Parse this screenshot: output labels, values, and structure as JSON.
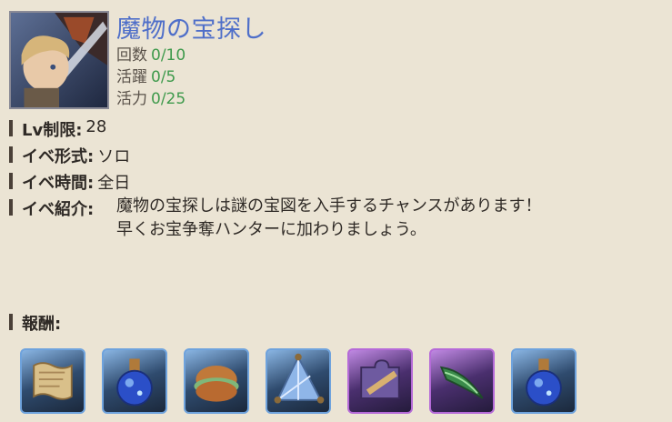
{
  "event": {
    "title": "魔物の宝探し",
    "stats": [
      {
        "label": "回数",
        "value": "0/10"
      },
      {
        "label": "活躍",
        "value": "0/5"
      },
      {
        "label": "活力",
        "value": "0/25"
      }
    ]
  },
  "info": {
    "level_key": "Lv制限:",
    "level_value": "28",
    "format_key": "イベ形式:",
    "format_value": "ソロ",
    "time_key": "イベ時間:",
    "time_value": "全日",
    "intro_key": "イベ紹介:",
    "intro_line1": "魔物の宝探しは謎の宝図を入手するチャンスがあります！",
    "intro_line2": "早くお宝争奪ハンターに加わりましょう。"
  },
  "rewards": {
    "heading": "報酬:",
    "items": [
      {
        "icon": "treasure-map-icon",
        "rarity": "blue"
      },
      {
        "icon": "blue-potion-icon",
        "rarity": "blue"
      },
      {
        "icon": "meat-bun-icon",
        "rarity": "blue"
      },
      {
        "icon": "crystal-shard-icon",
        "rarity": "blue"
      },
      {
        "icon": "puzzle-piece-weapon-icon",
        "rarity": "purple"
      },
      {
        "icon": "green-blade-icon",
        "rarity": "purple"
      },
      {
        "icon": "blue-potion-icon",
        "rarity": "blue"
      }
    ]
  }
}
